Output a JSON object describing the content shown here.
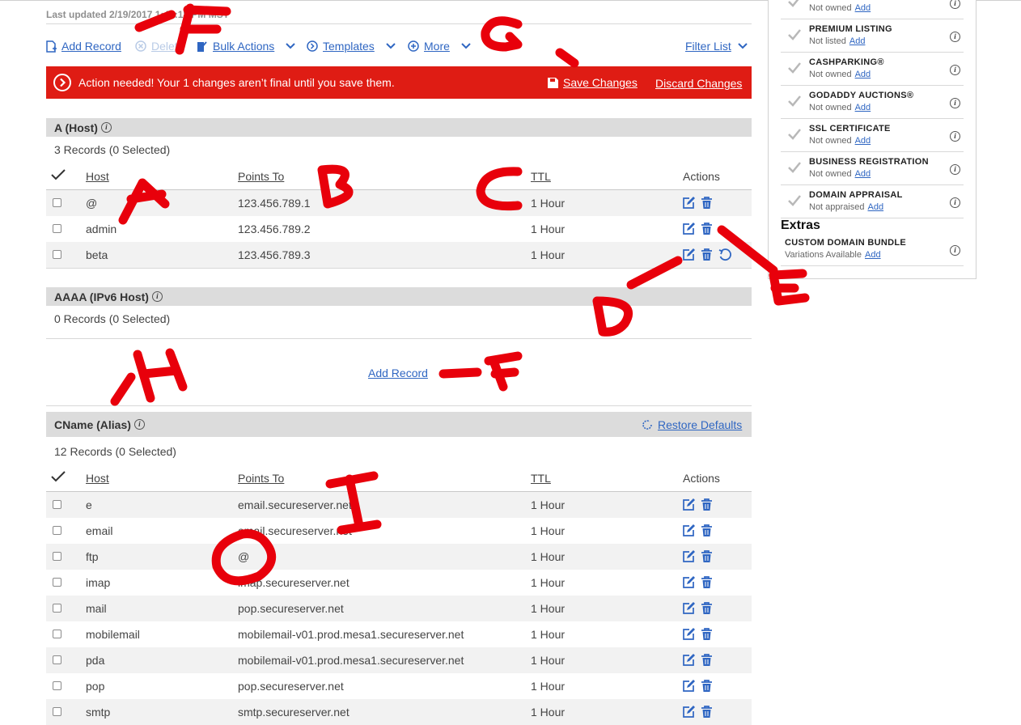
{
  "last_updated": "Last updated 2/19/2017 1:41:18 PM MST",
  "toolbar": {
    "add_record": "Add Record",
    "delete": "Delete",
    "bulk_actions": "Bulk Actions",
    "templates": "Templates",
    "more": "More",
    "filter_list": "Filter List"
  },
  "banner": {
    "message": "Action needed! Your 1 changes aren’t final until you save them.",
    "save": "Save Changes",
    "discard": "Discard Changes",
    "color": "#df1c14"
  },
  "columns": {
    "host": "Host",
    "points_to": "Points To",
    "ttl": "TTL",
    "actions": "Actions"
  },
  "a_section": {
    "title": "A (Host)",
    "count": "3 Records (0 Selected)",
    "rows": [
      {
        "host": "@",
        "points": "123.456.789.1",
        "ttl": "1 Hour"
      },
      {
        "host": "admin",
        "points": "123.456.789.2",
        "ttl": "1 Hour"
      },
      {
        "host": "beta",
        "points": "123.456.789.3",
        "ttl": "1 Hour"
      }
    ]
  },
  "aaaa_section": {
    "title": "AAAA (IPv6 Host)",
    "count": "0 Records (0 Selected)",
    "add_record": "Add Record"
  },
  "cname_section": {
    "title": "CName (Alias)",
    "count": "12 Records (0 Selected)",
    "restore": "Restore Defaults",
    "rows": [
      {
        "host": "e",
        "points": "email.secureserver.net",
        "ttl": "1 Hour"
      },
      {
        "host": "email",
        "points": "email.secureserver.net",
        "ttl": "1 Hour"
      },
      {
        "host": "ftp",
        "points": "@",
        "ttl": "1 Hour"
      },
      {
        "host": "imap",
        "points": "imap.secureserver.net",
        "ttl": "1 Hour"
      },
      {
        "host": "mail",
        "points": "pop.secureserver.net",
        "ttl": "1 Hour"
      },
      {
        "host": "mobilemail",
        "points": "mobilemail-v01.prod.mesa1.secureserver.net",
        "ttl": "1 Hour"
      },
      {
        "host": "pda",
        "points": "mobilemail-v01.prod.mesa1.secureserver.net",
        "ttl": "1 Hour"
      },
      {
        "host": "pop",
        "points": "pop.secureserver.net",
        "ttl": "1 Hour"
      },
      {
        "host": "smtp",
        "points": "smtp.secureserver.net",
        "ttl": "1 Hour"
      }
    ]
  },
  "sidebar": {
    "items": [
      {
        "title": "",
        "status": "Not owned",
        "action": "Add"
      },
      {
        "title": "PREMIUM LISTING",
        "status": "Not listed",
        "action": "Add"
      },
      {
        "title": "CASHPARKING®",
        "status": "Not owned",
        "action": "Add"
      },
      {
        "title": "GODADDY AUCTIONS®",
        "status": "Not owned",
        "action": "Add"
      },
      {
        "title": "SSL CERTIFICATE",
        "status": "Not owned",
        "action": "Add"
      },
      {
        "title": "BUSINESS REGISTRATION",
        "status": "Not owned",
        "action": "Add"
      },
      {
        "title": "DOMAIN APPRAISAL",
        "status": "Not appraised",
        "action": "Add"
      }
    ],
    "extras_heading": "Extras",
    "extras_items": [
      {
        "title": "CUSTOM DOMAIN BUNDLE",
        "status": "Variations Available",
        "action": "Add"
      }
    ]
  },
  "annotations": {
    "color": "#e8000b",
    "letters": [
      "A",
      "B",
      "C",
      "D",
      "E",
      "F",
      "G",
      "H",
      "I",
      "O"
    ]
  }
}
